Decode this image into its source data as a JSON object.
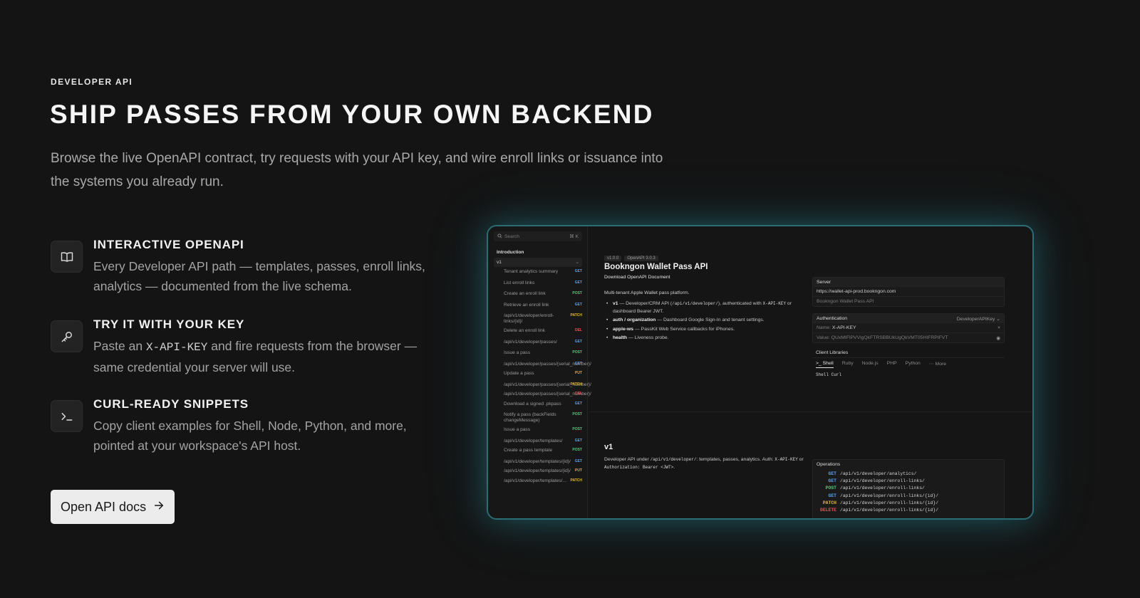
{
  "hero": {
    "eyebrow": "DEVELOPER API",
    "headline": "SHIP PASSES FROM YOUR OWN BACKEND",
    "lead": "Browse the live OpenAPI contract, try requests with your API key, and wire enroll links or issuance into the systems you already run."
  },
  "features": [
    {
      "icon": "book-icon",
      "title": "INTERACTIVE OPENAPI",
      "desc": "Every Developer API path — templates, passes, enroll links, analytics — documented from the live schema."
    },
    {
      "icon": "key-icon",
      "title": "TRY IT WITH YOUR KEY",
      "desc_pre": "Paste an ",
      "desc_code": "X-API-KEY",
      "desc_post": " and fire requests from the browser — same credential your server will use."
    },
    {
      "icon": "terminal-icon",
      "title": "CURL-READY SNIPPETS",
      "desc": "Copy client examples for Shell, Node, Python, and more, pointed at your workspace's API host."
    }
  ],
  "cta": {
    "label": "Open API docs",
    "icon": "arrow-right-icon"
  },
  "docs": {
    "search_placeholder": "Search",
    "search_shortcut": "⌘ K",
    "intro_label": "Introduction",
    "group_label": "v1",
    "nav": [
      {
        "label": "Tenant analytics summary",
        "method": "GET"
      },
      {
        "label": "List enroll links",
        "method": "GET"
      },
      {
        "label": "Create an enroll link",
        "method": "POST"
      },
      {
        "label": "Retrieve an enroll link",
        "method": "GET"
      },
      {
        "label": "/api/v1/developer/enroll-links/{id}/",
        "method": "PATCH"
      },
      {
        "label": "Delete an enroll link",
        "method": "DEL"
      },
      {
        "label": "/api/v1/developer/passes/",
        "method": "GET"
      },
      {
        "label": "Issue a pass",
        "method": "POST"
      },
      {
        "label": "/api/v1/developer/passes/{serial_number}/",
        "method": "GET"
      },
      {
        "label": "Update a pass",
        "method": "PUT"
      },
      {
        "label": "/api/v1/developer/passes/{serial_number}/",
        "method": "PATCH"
      },
      {
        "label": "/api/v1/developer/passes/{serial_number}/",
        "method": "DEL"
      },
      {
        "label": "Download a signed .pkpass",
        "method": "GET"
      },
      {
        "label": "Notify a pass (backFields changeMessage)",
        "method": "POST"
      },
      {
        "label": "Issue a pass",
        "method": "POST"
      },
      {
        "label": "/api/v1/developer/templates/",
        "method": "GET"
      },
      {
        "label": "Create a pass template",
        "method": "POST"
      },
      {
        "label": "/api/v1/developer/templates/{id}/",
        "method": "GET"
      },
      {
        "label": "/api/v1/developer/templates/{id}/",
        "method": "PUT"
      },
      {
        "label": "/api/v1/developer/templates/...",
        "method": "PATCH"
      }
    ],
    "version_badge": "v1.0.0",
    "openapi_badge": "OpenAPI 3.0.3",
    "title": "Bookngon Wallet Pass API",
    "download_label": "Download OpenAPI Document",
    "description": "Multi-tenant Apple Wallet pass platform.",
    "bullets": {
      "b1_name": "v1",
      "b1_text_pre": " — Developer/CRM API (",
      "b1_code1": "/api/v1/developer/",
      "b1_text_mid": "), authenticated with ",
      "b1_code2": "X-API-KEY",
      "b1_text_post": " or dashboard Bearer JWT.",
      "b2_name": "auth / organization",
      "b2_text": " — Dashboard Google Sign-In and tenant settings.",
      "b3_name": "apple-ws",
      "b3_text": " — PassKit Web Service callbacks for iPhones.",
      "b4_name": "health",
      "b4_text": " — Liveness probe."
    },
    "server": {
      "label": "Server",
      "url": "https://wallet-api-prod.bookngon.com",
      "name": "Bookngon Wallet Pass API"
    },
    "auth": {
      "label": "Authentication",
      "scheme": "DeveloperAPIKey ⌄",
      "name_label": "Name:",
      "name_value": "X-API-KEY",
      "value_label": "Value:",
      "value": "QUxMIFlPVVlgQkFTRSBBUkUgQkVMT05HIFRPIFVT"
    },
    "clients": {
      "label": "Client Libraries",
      "tabs": [
        ">_ Shell",
        "Ruby",
        "Node.js",
        "PHP",
        "Python",
        "⋯ More"
      ],
      "selected": "Shell Curl"
    },
    "v1_section": {
      "title": "v1",
      "desc_pre": "Developer API under ",
      "desc_code1": "/api/v1/developer/",
      "desc_mid": ": templates, passes, analytics. Auth: ",
      "desc_code2": "X-API-KEY",
      "desc_mid2": " or ",
      "desc_code3": "Authorization: Bearer <JWT>",
      "desc_post": "."
    },
    "operations": {
      "label": "Operations",
      "rows": [
        {
          "method": "GET",
          "path": "/api/v1/developer/analytics/"
        },
        {
          "method": "GET",
          "path": "/api/v1/developer/enroll-links/"
        },
        {
          "method": "POST",
          "path": "/api/v1/developer/enroll-links/"
        },
        {
          "method": "GET",
          "path": "/api/v1/developer/enroll-links/{id}/"
        },
        {
          "method": "PATCH",
          "path": "/api/v1/developer/enroll-links/{id}/"
        },
        {
          "method": "DELETE",
          "path": "/api/v1/developer/enroll-links/{id}/"
        }
      ]
    }
  }
}
